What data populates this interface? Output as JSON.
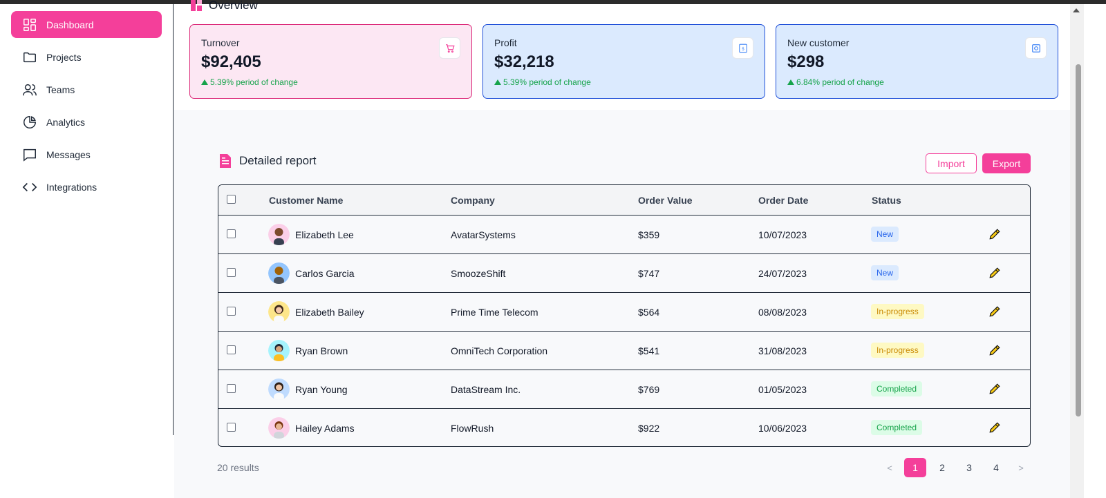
{
  "sidebar": {
    "items": [
      {
        "label": "Dashboard",
        "icon": "grid-icon",
        "active": true
      },
      {
        "label": "Projects",
        "icon": "folder-icon"
      },
      {
        "label": "Teams",
        "icon": "users-icon"
      },
      {
        "label": "Analytics",
        "icon": "pie-chart-icon"
      },
      {
        "label": "Messages",
        "icon": "message-icon"
      },
      {
        "label": "Integrations",
        "icon": "code-icon"
      }
    ]
  },
  "overview": {
    "title": "Overview",
    "cards": [
      {
        "label": "Turnover",
        "value": "$92,405",
        "change": "5.39% period of change",
        "icon": "cart-icon",
        "theme": "pink"
      },
      {
        "label": "Profit",
        "value": "$32,218",
        "change": "5.39% period of change",
        "icon": "dollar-icon",
        "theme": "blue"
      },
      {
        "label": "New customer",
        "value": "$298",
        "change": "6.84% period of change",
        "icon": "gear-icon",
        "theme": "blue"
      }
    ]
  },
  "report": {
    "title": "Detailed report",
    "import_label": "Import",
    "export_label": "Export",
    "columns": [
      "Customer Name",
      "Company",
      "Order Value",
      "Order Date",
      "Status"
    ],
    "rows": [
      {
        "name": "Elizabeth Lee",
        "company": "AvatarSystems",
        "value": "$359",
        "date": "10/07/2023",
        "status": "New",
        "status_type": "new"
      },
      {
        "name": "Carlos Garcia",
        "company": "SmoozeShift",
        "value": "$747",
        "date": "24/07/2023",
        "status": "New",
        "status_type": "new"
      },
      {
        "name": "Elizabeth Bailey",
        "company": "Prime Time Telecom",
        "value": "$564",
        "date": "08/08/2023",
        "status": "In-progress",
        "status_type": "prog"
      },
      {
        "name": "Ryan Brown",
        "company": "OmniTech Corporation",
        "value": "$541",
        "date": "31/08/2023",
        "status": "In-progress",
        "status_type": "prog"
      },
      {
        "name": "Ryan Young",
        "company": "DataStream Inc.",
        "value": "$769",
        "date": "01/05/2023",
        "status": "Completed",
        "status_type": "done"
      },
      {
        "name": "Hailey Adams",
        "company": "FlowRush",
        "value": "$922",
        "date": "10/06/2023",
        "status": "Completed",
        "status_type": "done"
      }
    ],
    "results_text": "20 results",
    "pagination": {
      "prev": "<",
      "pages": [
        "1",
        "2",
        "3",
        "4"
      ],
      "current": "1",
      "next": ">"
    }
  },
  "colors": {
    "accent": "#f43f9a",
    "success": "#16a34a"
  }
}
